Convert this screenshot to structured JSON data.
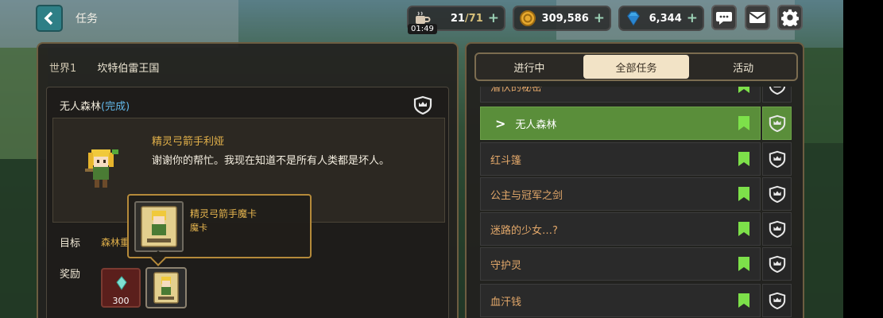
{
  "header": {
    "title": "任务",
    "energy": {
      "current": "21",
      "max": "/71",
      "timer": "01:49"
    },
    "gold": "309,586",
    "gems": "6,344"
  },
  "left": {
    "world": "世界1",
    "region": "坎特伯雷王国",
    "quest_name": "无人森林",
    "quest_status": "(完成)",
    "npc_name": "精灵弓箭手利娅",
    "npc_line": "谢谢你的帮忙。我现在知道不是所有人类都是坏人。",
    "target_label": "目标",
    "target_value": "森林重",
    "reward_label": "奖励",
    "reward_gem_count": "300",
    "tooltip": {
      "name": "精灵弓箭手魔卡",
      "type": "魔卡"
    }
  },
  "tabs": [
    {
      "label": "进行中"
    },
    {
      "label": "全部任务"
    },
    {
      "label": "活动"
    }
  ],
  "quests": [
    {
      "name": "潜伏的秘密"
    },
    {
      "name": "无人森林"
    },
    {
      "name": "红斗篷"
    },
    {
      "name": "公主与冠军之剑"
    },
    {
      "name": "迷路的少女…?"
    },
    {
      "name": "守护灵"
    },
    {
      "name": "血汗钱"
    }
  ],
  "colors": {
    "accent_green": "#5a8e3a",
    "bookmark_green": "#7de04a",
    "gold_text": "#e1b04a",
    "done_blue": "#62b7e8"
  },
  "icons": [
    "back-arrow-icon",
    "coffee-icon",
    "gold-coin-icon",
    "gem-icon",
    "chat-icon",
    "mail-icon",
    "gear-icon",
    "shield-crown-icon",
    "bookmark-icon"
  ]
}
